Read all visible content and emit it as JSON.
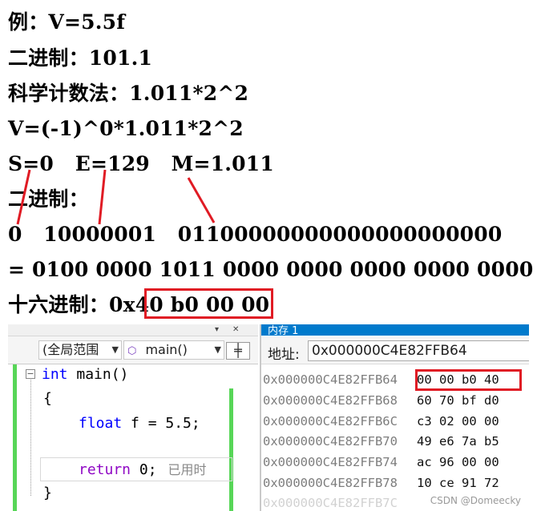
{
  "notes": {
    "line1": "例：V=5.5f",
    "line2": "二进制：101.1",
    "line3": "科学计数法：1.011*2^2",
    "line4": "V=(-1)^0*1.011*2^2",
    "line5": "S=0   E=129   M=1.011",
    "line6": "二进制：",
    "line7": "0   10000001   01100000000000000000000",
    "line8": "= 0100 0000 1011 0000 0000 0000 0000 0000",
    "line9": "十六进制：0x40 b0 00 00"
  },
  "colors": {
    "highlight_box": "#e01b24",
    "accent": "#007acc",
    "margin_green": "#57d657"
  },
  "editor": {
    "scope_dropdown": "(全局范围",
    "function_dropdown": "main()",
    "function_icon": "cube-icon",
    "code": {
      "line1_kw": "int",
      "line1_rest": " main()",
      "line2": "{",
      "line3_kw": "float",
      "line3_rest": " f = 5.5;",
      "line5_kw": "return",
      "line5_rest": " 0;",
      "line5_hint": "已用时",
      "line6": "}"
    }
  },
  "memory": {
    "title": "内存 1",
    "address_label": "地址:",
    "address_value": "0x000000C4E82FFB64",
    "rows": [
      {
        "addr": "0x000000C4E82FFB64",
        "bytes": "00 00 b0 40"
      },
      {
        "addr": "0x000000C4E82FFB68",
        "bytes": "60 70 bf d0"
      },
      {
        "addr": "0x000000C4E82FFB6C",
        "bytes": "c3 02 00 00"
      },
      {
        "addr": "0x000000C4E82FFB70",
        "bytes": "49 e6 7a b5"
      },
      {
        "addr": "0x000000C4E82FFB74",
        "bytes": "ac 96 00 00"
      },
      {
        "addr": "0x000000C4E82FFB78",
        "bytes": "10 ce 91 72"
      },
      {
        "addr": "0x000000C4E82FFB7C",
        "bytes": ""
      }
    ]
  },
  "watermark": "CSDN @Domeecky"
}
